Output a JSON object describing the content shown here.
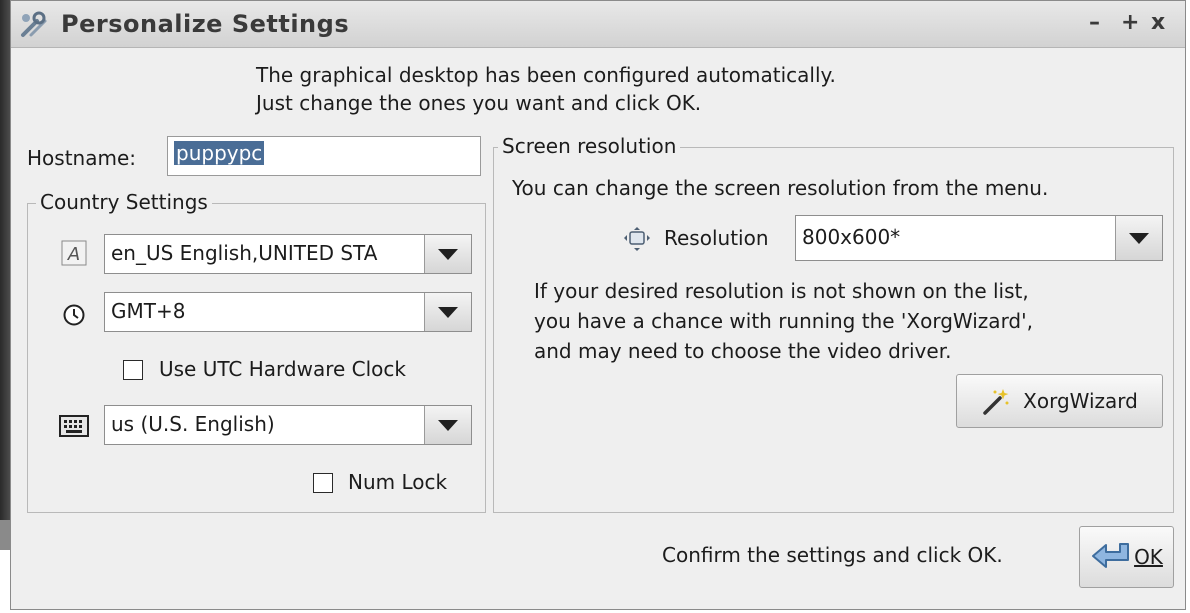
{
  "window": {
    "title": "Personalize Settings",
    "controls": {
      "minimize": "–",
      "maximize": "+",
      "close": "x"
    }
  },
  "intro": {
    "line1": "The graphical desktop has been configured automatically.",
    "line2": "Just change the ones you want and click OK."
  },
  "hostname": {
    "label": "Hostname:",
    "value": "puppypc"
  },
  "country": {
    "group_title": "Country Settings",
    "locale_icon_text": "A",
    "locale_value": "en_US English,UNITED STA",
    "timezone_value": "GMT+8",
    "utc_label": "Use UTC Hardware Clock",
    "utc_checked": false,
    "keyboard_value": "us (U.S. English)",
    "numlock_label": "Num Lock",
    "numlock_checked": false
  },
  "screen": {
    "group_title": "Screen resolution",
    "info": "You can change the screen resolution from the menu.",
    "resolution_label": "Resolution",
    "resolution_value": "800x600*",
    "help_line1": "If your desired resolution is not shown on the list,",
    "help_line2": "you have a chance with running the 'XorgWizard',",
    "help_line3": "and may need to choose the video driver.",
    "wizard_button": "XorgWizard"
  },
  "footer": {
    "confirm_text": "Confirm the settings and click OK.",
    "ok_button": "OK"
  },
  "icons": [
    "tools-icon",
    "font-icon",
    "clock-icon",
    "keyboard-icon",
    "monitor-resize-icon",
    "magic-wand-icon",
    "ok-arrow-icon"
  ]
}
